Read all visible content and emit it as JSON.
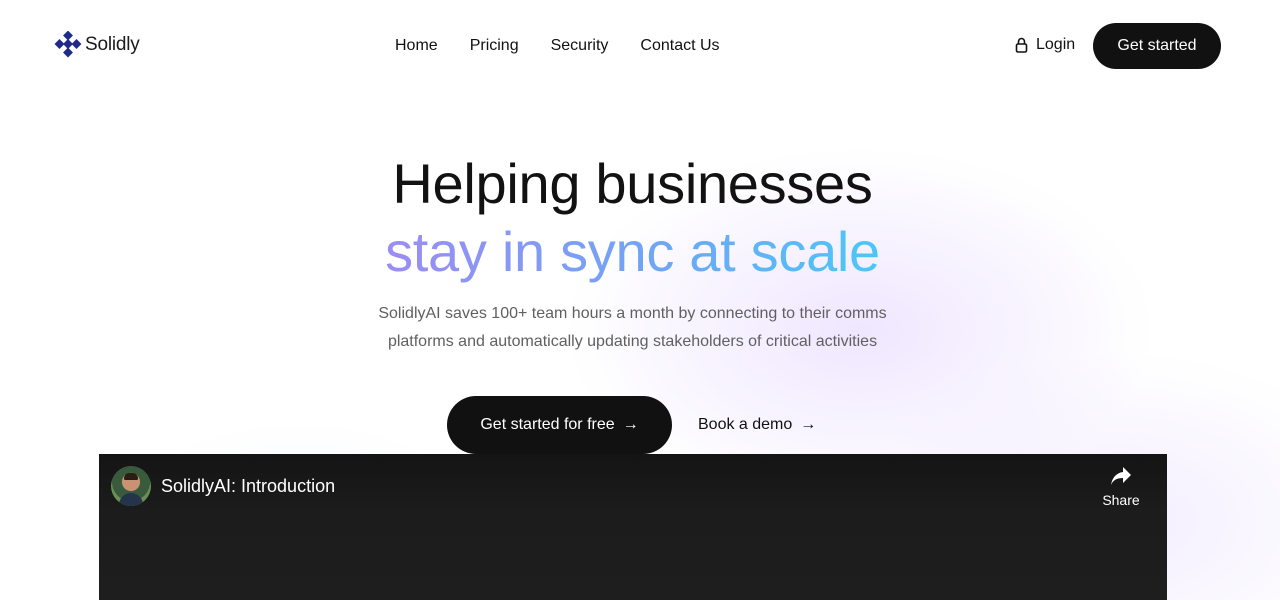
{
  "brand": {
    "name": "Solidly",
    "logo_color": "#1f2a8a"
  },
  "nav": {
    "links": [
      "Home",
      "Pricing",
      "Security",
      "Contact Us"
    ],
    "login_label": "Login",
    "login_icon": "lock-icon",
    "cta_label": "Get started"
  },
  "hero": {
    "title": "Helping businesses",
    "subtitle": "stay in sync at scale",
    "description_line1": "SolidlyAI saves 100+ team hours a month by connecting to their comms",
    "description_line2": "platforms and automatically updating stakeholders of critical activities",
    "primary_cta": "Get started for free",
    "secondary_cta": "Book a demo",
    "arrow_icon": "arrow-right-icon",
    "gradient_colors": [
      "#9b8cf4",
      "#6fa6f5",
      "#4cc7f7"
    ]
  },
  "video": {
    "title": "SolidlyAI: Introduction",
    "share_label": "Share",
    "share_icon": "share-icon"
  }
}
